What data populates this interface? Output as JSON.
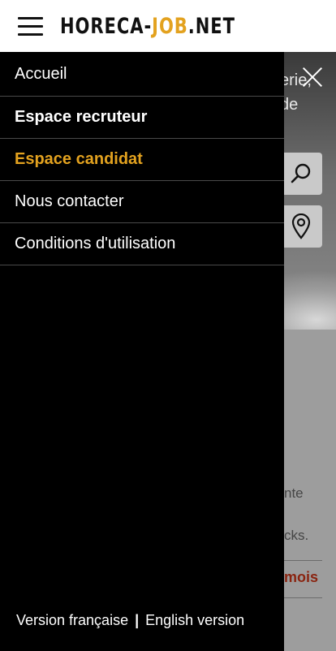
{
  "header": {
    "logo_part1": "HORECA-",
    "logo_part2": "JOB",
    "logo_part3": ".NET"
  },
  "drawer": {
    "items": [
      {
        "label": "Accueil"
      },
      {
        "label": "Espace recruteur"
      },
      {
        "label": "Espace candidat"
      },
      {
        "label": "Nous contacter"
      },
      {
        "label": "Conditions d'utilisation"
      }
    ],
    "language": {
      "french": "Version française",
      "separator": "|",
      "english": "English version"
    }
  },
  "background": {
    "hero_line1": "erie,",
    "hero_line2": "de",
    "text1": "nte",
    "text2": "cks.",
    "link": "mois"
  },
  "colors": {
    "accent": "#e3a21f",
    "drawer_bg": "#000000"
  }
}
